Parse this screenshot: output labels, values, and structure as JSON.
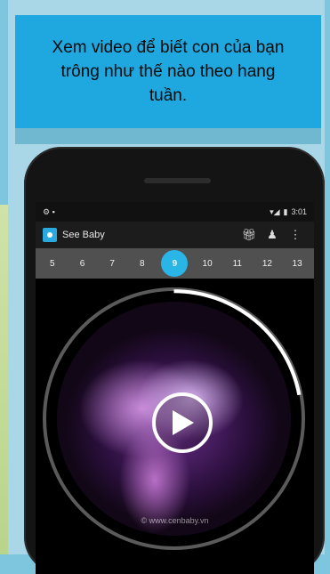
{
  "banner": {
    "text": "Xem video để biết con của bạn trông như thế nào theo hang tuần."
  },
  "statusbar": {
    "time": "3:01"
  },
  "appbar": {
    "title": "See Baby",
    "icons": [
      "gift-icon",
      "person-icon",
      "more-vert-icon"
    ]
  },
  "weeks": [
    "5",
    "6",
    "7",
    "8",
    "9",
    "10",
    "11",
    "12",
    "13"
  ],
  "selected_week": "9",
  "player": {
    "progress": 0.22,
    "watermark": "© www.cenbaby.vn"
  },
  "colors": {
    "accent": "#29b6e6",
    "banner": "#1fa8df",
    "page_bg": "#7ec5de"
  }
}
